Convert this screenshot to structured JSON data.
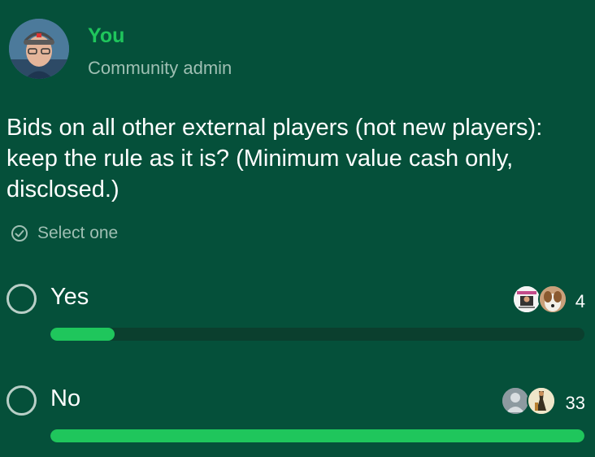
{
  "author": {
    "name": "You",
    "role": "Community admin"
  },
  "poll": {
    "question": "Bids on all other external players (not new players): keep the rule as it is? (Minimum value cash only, disclosed.)",
    "select_hint": "Select one",
    "options": [
      {
        "label": "Yes",
        "votes": "4",
        "fill_fraction": 0.12
      },
      {
        "label": "No",
        "votes": "33",
        "fill_fraction": 1.0
      }
    ]
  },
  "colors": {
    "background": "#05503a",
    "accent": "#1fc65c",
    "muted_text": "#9fbfb3",
    "track": "#0b3f2e"
  }
}
